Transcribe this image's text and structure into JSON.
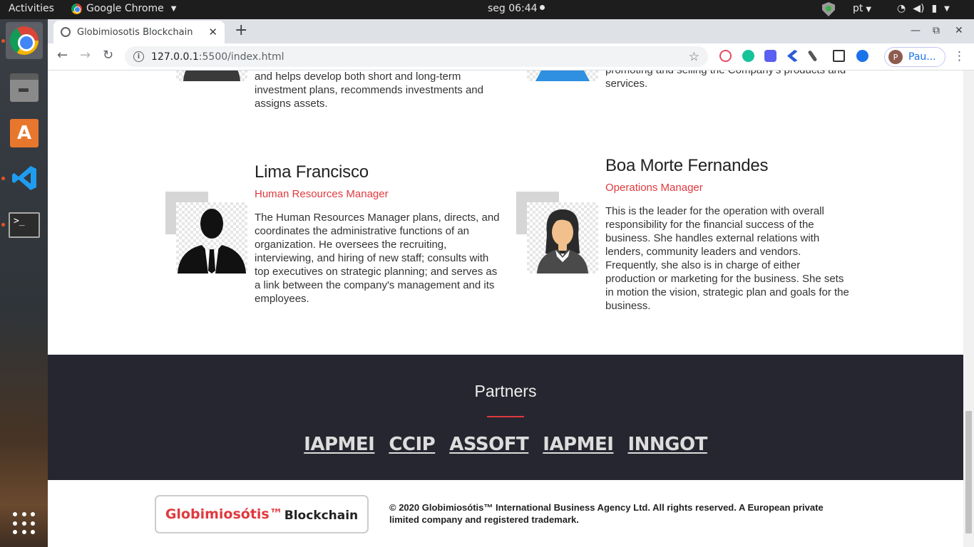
{
  "ubuntu": {
    "activities": "Activities",
    "app_name": "Google Chrome",
    "clock": "seg 06:44",
    "lang": "pt"
  },
  "browser": {
    "tab_title": "Globimiosotis Blockchain",
    "url_host": "127.0.0.1",
    "url_rest": ":5500/index.html",
    "profile_initial": "P",
    "profile_name": "Pau..."
  },
  "team": [
    {
      "name": "",
      "role": "",
      "description": "and helps develop both short and long-term investment plans, recommends investments and assigns assets."
    },
    {
      "name": "",
      "role": "",
      "description": "promoting and selling the Company's products and services."
    },
    {
      "name": "Lima Francisco",
      "role": "Human Resources Manager",
      "description": "The Human Resources Manager plans, directs, and coordinates the administrative functions of an organization. He oversees the recruiting, interviewing, and hiring of new staff; consults with top executives on strategic planning; and serves as a link between the company's management and its employees."
    },
    {
      "name": "Boa Morte Fernandes",
      "role": "Operations Manager",
      "description": "This is the leader for the operation with overall responsibility for the financial success of the business. She handles external relations with lenders, community leaders and vendors. Frequently, she also is in charge of either production or marketing for the business. She sets in motion the vision, strategic plan and goals for the business."
    }
  ],
  "partners": {
    "title": "Partners",
    "items": [
      "IAPMEI",
      "CCIP",
      "ASSOFT",
      "IAPMEI",
      "INNGOT"
    ]
  },
  "footer": {
    "logo_red": "Globimiosótis™",
    "logo_dark": "Blockchain",
    "copyright": "© 2020 Globimiosótis™ International Business Agency Ltd. All rights reserved. A European private limited company and registered trademark."
  },
  "colors": {
    "accent": "#e0393e",
    "partners_bg": "#262630"
  }
}
